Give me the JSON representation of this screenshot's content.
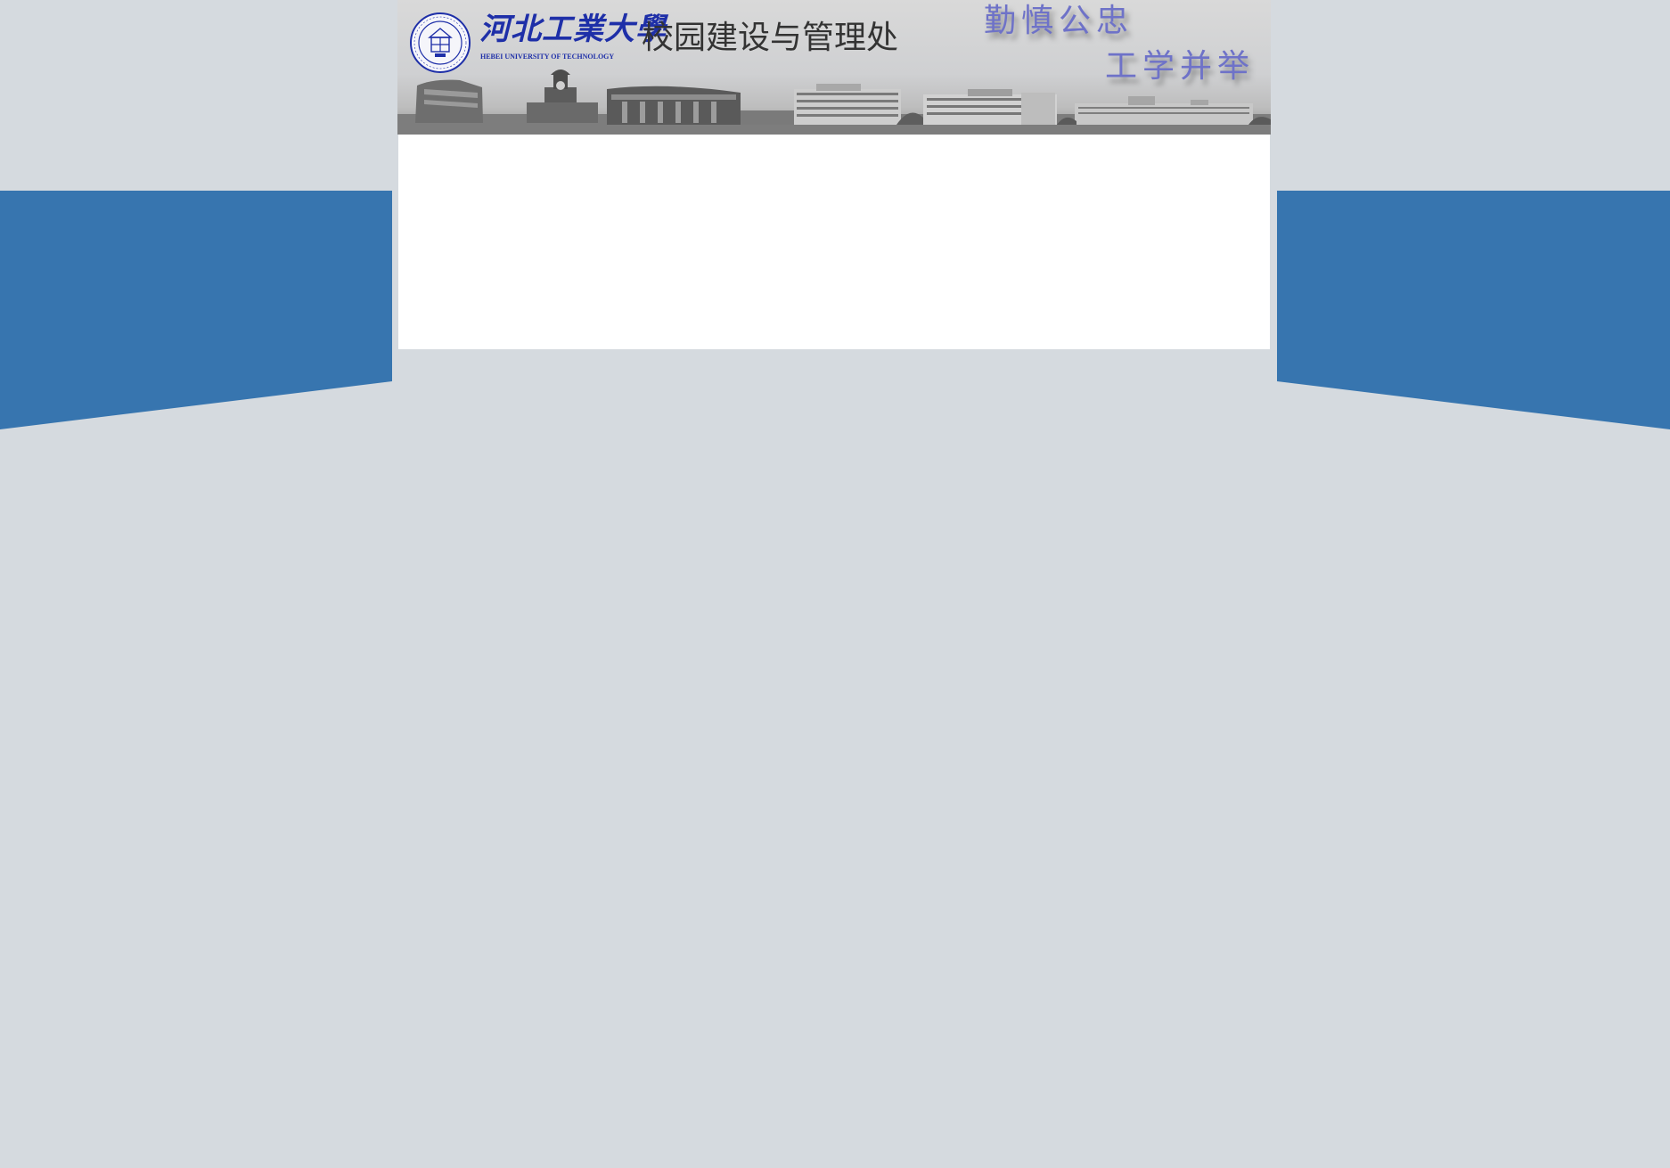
{
  "header": {
    "university_name_cn": "河北工業大學",
    "university_name_en": "HEBEI UNIVERSITY OF TECHNOLOGY",
    "department_title": "校园建设与管理处",
    "motto_line_1": "勤慎公忠",
    "motto_line_2": "工学并举",
    "logo_icon": "university-seal-icon",
    "skyline_image": "campus-skyline-illustration"
  },
  "colors": {
    "page_background": "#d5dadf",
    "side_band": "#3775af",
    "brand_blue": "#1e2fa8",
    "motto_purple": "#6e72c8",
    "title_gray": "#333333",
    "content_background": "#ffffff"
  }
}
